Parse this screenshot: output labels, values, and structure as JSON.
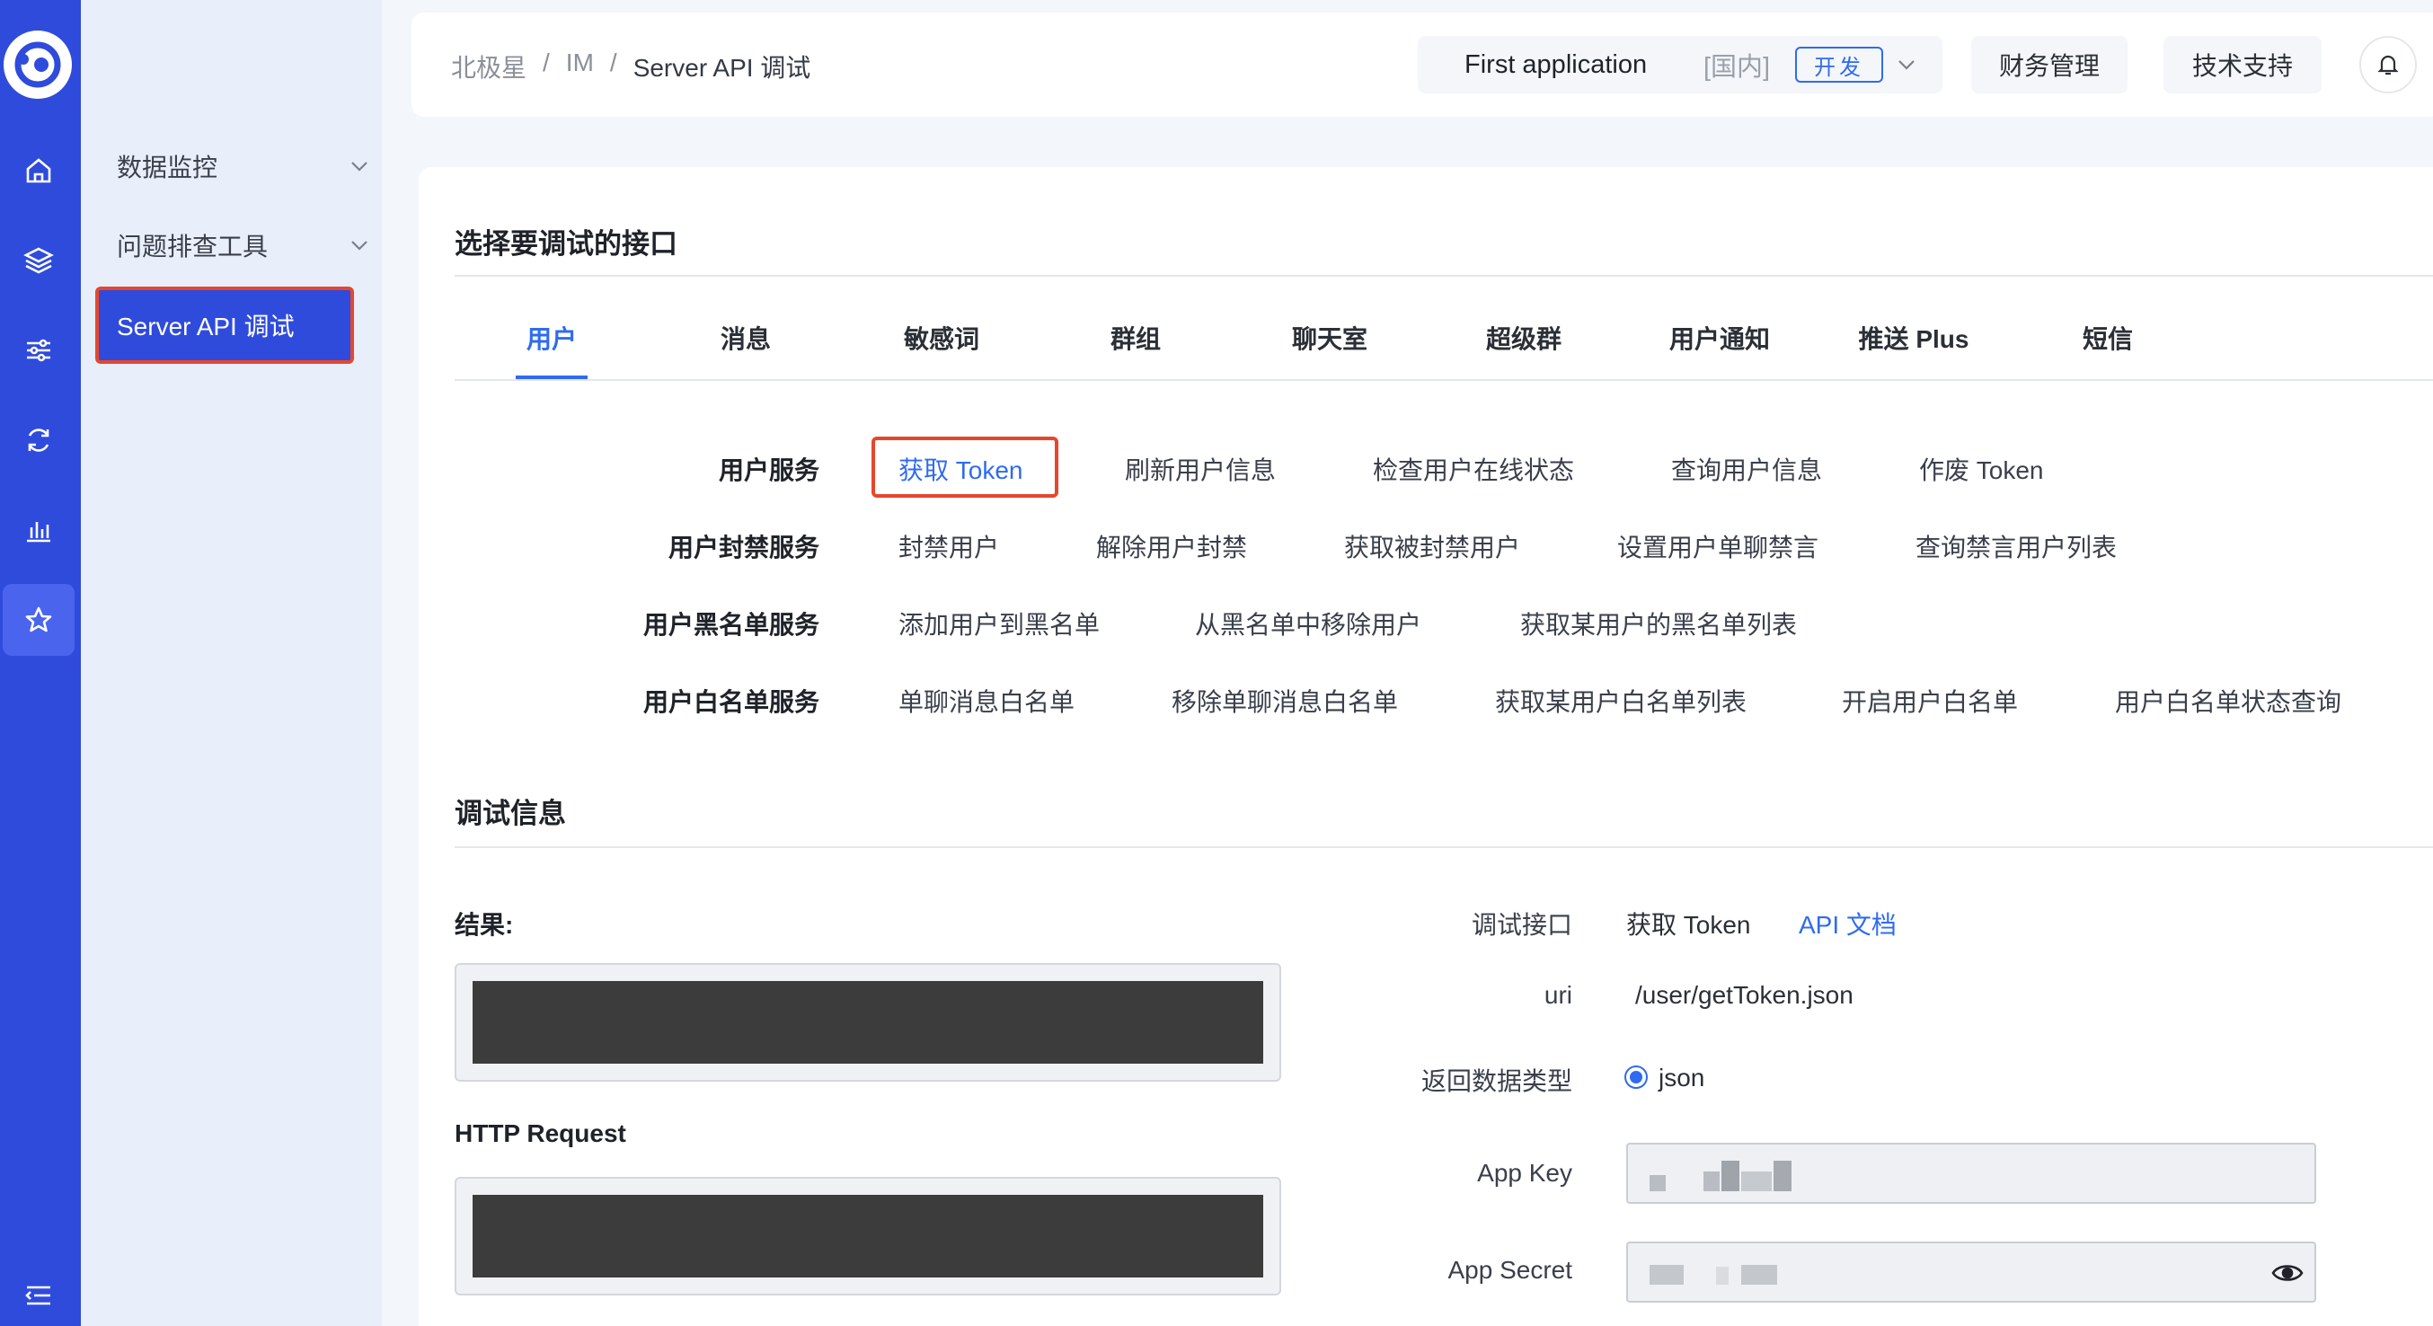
{
  "rail": {
    "items": [
      {
        "name": "home-icon",
        "active": false
      },
      {
        "name": "layers-icon",
        "active": false
      },
      {
        "name": "sliders-icon",
        "active": false
      },
      {
        "name": "refresh-icon",
        "active": false
      },
      {
        "name": "bar-chart-icon",
        "active": false
      },
      {
        "name": "star-icon",
        "active": true
      }
    ],
    "bottom_icon": "menu-collapse-icon"
  },
  "subnav": {
    "items": [
      {
        "label": "数据监控"
      },
      {
        "label": "问题排查工具"
      }
    ],
    "active_label": "Server API 调试"
  },
  "header": {
    "breadcrumb": [
      "北极星",
      "IM",
      "Server API 调试"
    ],
    "app_name": "First application",
    "app_region": "[国内]",
    "app_env": "开发",
    "finance_label": "财务管理",
    "support_label": "技术支持"
  },
  "main": {
    "select_title": "选择要调试的接口",
    "tabs": [
      "用户",
      "消息",
      "敏感词",
      "群组",
      "聊天室",
      "超级群",
      "用户通知",
      "推送 Plus",
      "短信"
    ],
    "active_tab": "用户",
    "rows": [
      {
        "label": "用户服务",
        "apis": [
          "获取 Token",
          "刷新用户信息",
          "检查用户在线状态",
          "查询用户信息",
          "作废 Token"
        ]
      },
      {
        "label": "用户封禁服务",
        "apis": [
          "封禁用户",
          "解除用户封禁",
          "获取被封禁用户",
          "设置用户单聊禁言",
          "查询禁言用户列表"
        ]
      },
      {
        "label": "用户黑名单服务",
        "apis": [
          "添加用户到黑名单",
          "从黑名单中移除用户",
          "获取某用户的黑名单列表"
        ]
      },
      {
        "label": "用户白名单服务",
        "apis": [
          "单聊消息白名单",
          "移除单聊消息白名单",
          "获取某用户白名单列表",
          "开启用户白名单",
          "用户白名单状态查询"
        ]
      }
    ],
    "selected_api": "获取 Token",
    "debug_title": "调试信息",
    "result_label": "结果:",
    "http_request_label": "HTTP Request",
    "fields": {
      "interface_label": "调试接口",
      "interface_value": "获取 Token",
      "doc_link": "API 文档",
      "uri_label": "uri",
      "uri_value": "/user/getToken.json",
      "return_type_label": "返回数据类型",
      "return_type_value": "json",
      "app_key_label": "App Key",
      "app_secret_label": "App Secret"
    }
  },
  "colors": {
    "brand": "#2f4bdc",
    "accent": "#2f6bf0",
    "highlight": "#e5472d"
  }
}
